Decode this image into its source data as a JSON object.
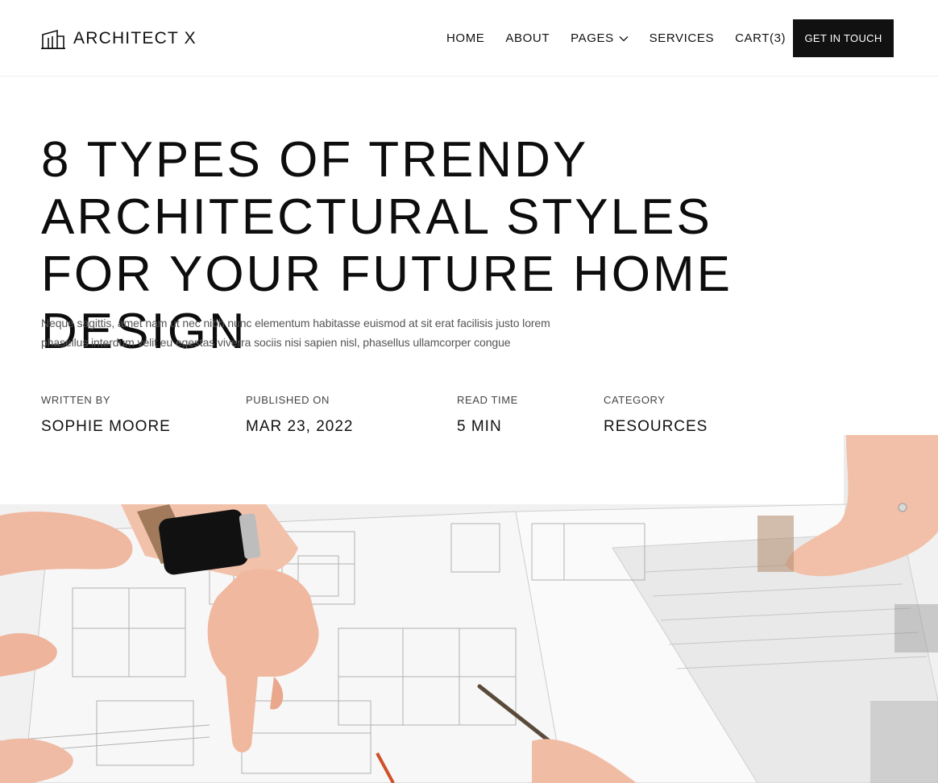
{
  "header": {
    "brand": "ARCHITECT X",
    "nav": [
      {
        "label": "HOME"
      },
      {
        "label": "ABOUT"
      },
      {
        "label": "PAGES"
      },
      {
        "label": "SERVICES"
      },
      {
        "label": "CART(3)"
      }
    ],
    "cta_label": "GET IN TOUCH"
  },
  "article": {
    "title": "8 TYPES OF TRENDY ARCHITECTURAL STYLES FOR YOUR FUTURE HOME DESIGN",
    "excerpt": "Neque sagittis, amet nam ut nec nibh nunc elementum habitasse euismod at sit erat facilisis justo lorem phasellus interdum velit eu egestas viverra sociis nisi sapien nisl, phasellus ullamcorper congue",
    "meta": [
      {
        "label": "WRITTEN BY",
        "value": "SOPHIE MOORE"
      },
      {
        "label": "PUBLISHED ON",
        "value": "MAR 23, 2022"
      },
      {
        "label": "READ TIME",
        "value": "5 MIN"
      },
      {
        "label": "CATEGORY",
        "value": "RESOURCES"
      }
    ]
  },
  "colors": {
    "text": "#111111",
    "cta_background": "#111111",
    "cta_text": "#ffffff",
    "muted_text": "#555555"
  },
  "icons": {
    "logo": "building-icon",
    "pages_dropdown": "chevron-down-icon"
  }
}
